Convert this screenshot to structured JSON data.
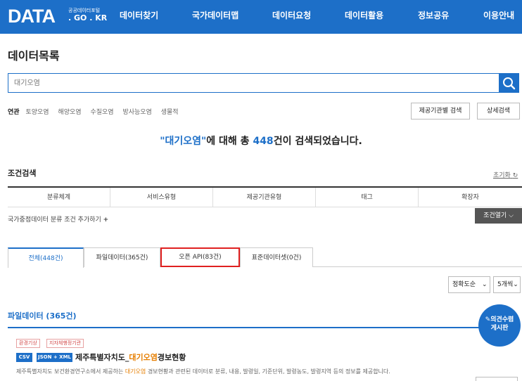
{
  "header": {
    "logo": "DATA",
    "logo_sub": "공공데이터포털",
    "logo_domain": ". GO . KR",
    "nav": [
      "데이터찾기",
      "국가데이터맵",
      "데이터요청",
      "데이터활용",
      "정보공유",
      "이용안내"
    ]
  },
  "page_title": "데이터목록",
  "search": {
    "placeholder": "대기오염",
    "button_icon": "search-icon"
  },
  "related": {
    "label": "연관",
    "terms": [
      "토양오염",
      "해양오염",
      "수질오염",
      "방사능오염",
      "생물적"
    ]
  },
  "buttons": {
    "org_search": "제공기관별 검색",
    "detail_search": "상세검색"
  },
  "result": {
    "query": "\"대기오염\"",
    "mid": "에 대해 총 ",
    "count": "448",
    "suffix": "건이 검색되었습니다."
  },
  "conditions": {
    "title": "조건검색",
    "reset": "초기화",
    "columns": [
      "분류체계",
      "서비스유형",
      "제공기관유형",
      "태그",
      "확장자"
    ],
    "add_label": "국가중점데이터 분류 조건 추가하기",
    "open_button": "조건열기"
  },
  "tabs": [
    "전체(448건)",
    "파일데이터(365건)",
    "오픈 API(83건)",
    "표준데이터셋(0건)"
  ],
  "sort": {
    "order": "정확도순",
    "per_page": "5개씩"
  },
  "file_section": {
    "title": "파일데이터 (365건)"
  },
  "item": {
    "tags": [
      "환경기상",
      "지자체행정기관"
    ],
    "formats": [
      "CSV",
      "JSON + XML"
    ],
    "title_prefix": "제주특별자치도_",
    "title_highlight": "대기오염",
    "title_suffix": "경보현황",
    "desc_prefix": "제주특별자치도 보건환경연구소에서 제공하는 ",
    "desc_highlight": "대기오염",
    "desc_suffix": " 경보현황과 관련된 데이터로 분류, 내용, 발령일, 기준단위, 발령농도, 발령지역 등의 정보를 제공합니다."
  },
  "float_button": {
    "line1": "의견수렴",
    "line2": "게시판"
  },
  "colors": {
    "brand": "#1d6fc8",
    "highlight": "#e67e00",
    "tab_focus": "#e02020"
  }
}
